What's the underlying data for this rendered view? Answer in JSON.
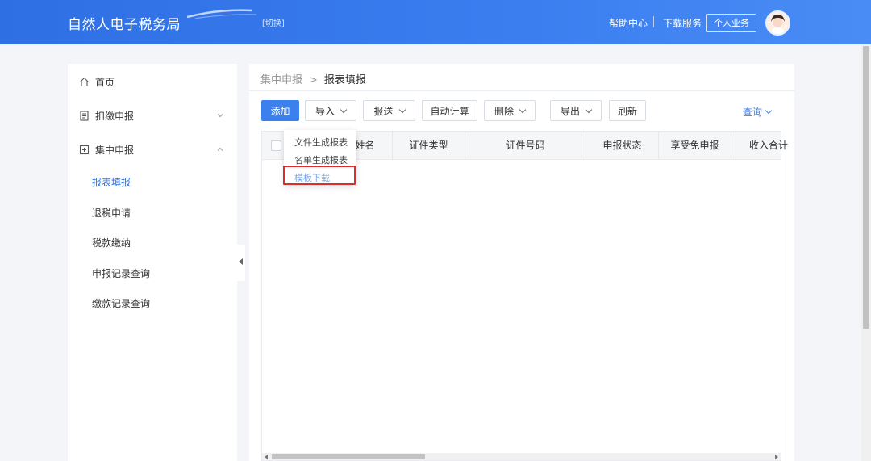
{
  "header": {
    "brand": "自然人电子税务局",
    "switch_label": "[切换]",
    "help_label": "帮助中心",
    "download_label": "下载服务",
    "personal_label": "个人业务"
  },
  "sidebar": {
    "items": [
      {
        "label": "首页",
        "icon": "home-icon"
      },
      {
        "label": "扣缴申报",
        "icon": "document-icon"
      },
      {
        "label": "集中申报",
        "icon": "form-icon"
      }
    ],
    "sub_items": [
      {
        "label": "报表填报",
        "active": true
      },
      {
        "label": "退税申请"
      },
      {
        "label": "税款缴纳"
      },
      {
        "label": "申报记录查询"
      },
      {
        "label": "缴款记录查询"
      }
    ]
  },
  "breadcrumb": {
    "root": "集中申报",
    "separator": ">",
    "current": "报表填报"
  },
  "toolbar": {
    "add": "添加",
    "import": "导入",
    "send": "报送",
    "auto_calc": "自动计算",
    "delete": "删除",
    "export": "导出",
    "refresh": "刷新",
    "query": "查询"
  },
  "table": {
    "columns": [
      "姓名",
      "证件类型",
      "证件号码",
      "申报状态",
      "享受免申报",
      "收入合计"
    ]
  },
  "import_menu": {
    "items": [
      "文件生成报表",
      "名单生成报表",
      "模板下载"
    ]
  },
  "colors": {
    "header_blue": "#2f6fe4",
    "primary": "#3c80ee",
    "highlight": "#e02b2b"
  }
}
